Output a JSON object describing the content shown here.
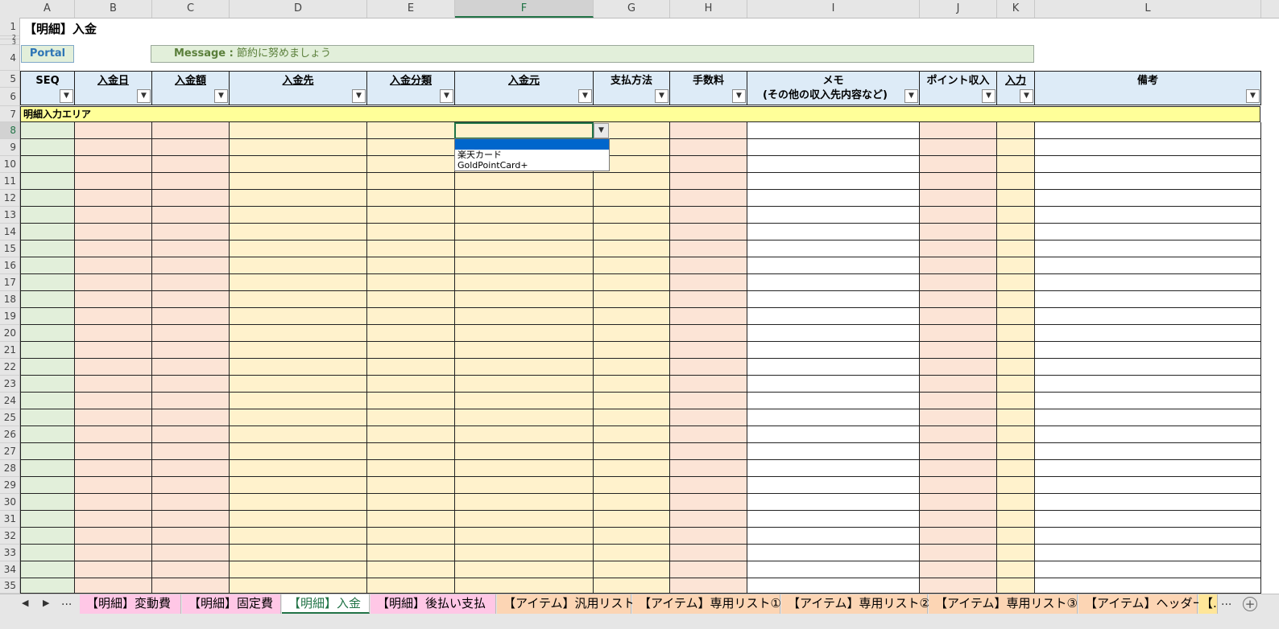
{
  "columns": [
    "A",
    "B",
    "C",
    "D",
    "E",
    "F",
    "G",
    "H",
    "I",
    "J",
    "K",
    "L"
  ],
  "selected_column": "F",
  "rows": [
    "1",
    "2",
    "3",
    "4",
    "5",
    "6",
    "7",
    "8",
    "9",
    "10",
    "11",
    "12",
    "13",
    "14",
    "15",
    "16",
    "17",
    "18",
    "19",
    "20",
    "21",
    "22",
    "23",
    "24",
    "25",
    "26",
    "27",
    "28",
    "29",
    "30",
    "31",
    "32",
    "33",
    "34",
    "35"
  ],
  "selected_row": "8",
  "title": "【明細】入金",
  "portal_label": "Portal",
  "message": {
    "label": "Message :",
    "text": "節約に努めましょう"
  },
  "headers": [
    {
      "line1": "SEQ",
      "line2": "",
      "underline": false
    },
    {
      "line1": "入金日",
      "line2": "",
      "underline": true
    },
    {
      "line1": "入金額",
      "line2": "",
      "underline": true
    },
    {
      "line1": "入金先",
      "line2": "",
      "underline": true
    },
    {
      "line1": "入金分類",
      "line2": "",
      "underline": true
    },
    {
      "line1": "入金元",
      "line2": "",
      "underline": true
    },
    {
      "line1": "支払方法",
      "line2": "",
      "underline": false
    },
    {
      "line1": "手数料",
      "line2": "",
      "underline": false
    },
    {
      "line1": "メモ",
      "line2": "(その他の収入先内容など)",
      "underline": false
    },
    {
      "line1": "ポイント収入",
      "line2": "",
      "underline": false
    },
    {
      "line1": "入力",
      "line2": "",
      "underline": true
    },
    {
      "line1": "備考",
      "line2": "",
      "underline": false
    }
  ],
  "input_area_label": "明細入力エリア",
  "dropdown_options": [
    "",
    "楽天カード",
    "GoldPointCard+"
  ],
  "colors": {
    "green": "#e2efda",
    "salmon": "#fce4d6",
    "yellow": "#fff2cc",
    "white": "#ffffff",
    "header": "#ddebf7",
    "accent": "#217346"
  },
  "sheet_tabs": [
    {
      "label": "【明細】変動費",
      "color": "#ffc7e6",
      "active": false
    },
    {
      "label": "【明細】固定費",
      "color": "#ffc7e6",
      "active": false
    },
    {
      "label": "【明細】入金",
      "color": "#ffffff",
      "active": true
    },
    {
      "label": "【明細】後払い支払",
      "color": "#ffc7e6",
      "active": false
    },
    {
      "label": "【アイテム】汎用リスト",
      "color": "#fcd5b4",
      "active": false
    },
    {
      "label": "【アイテム】専用リスト①",
      "color": "#fcd5b4",
      "active": false
    },
    {
      "label": "【アイテム】専用リスト②",
      "color": "#fcd5b4",
      "active": false
    },
    {
      "label": "【アイテム】専用リスト③",
      "color": "#fcd5b4",
      "active": false
    },
    {
      "label": "【アイテム】ヘッダー",
      "color": "#fcd5b4",
      "active": false
    },
    {
      "label": "【.",
      "color": "#ffe699",
      "active": false
    }
  ],
  "nav": {
    "prev": "◀",
    "next": "▶",
    "more": "...",
    "more_right": "...",
    "add": "+"
  }
}
